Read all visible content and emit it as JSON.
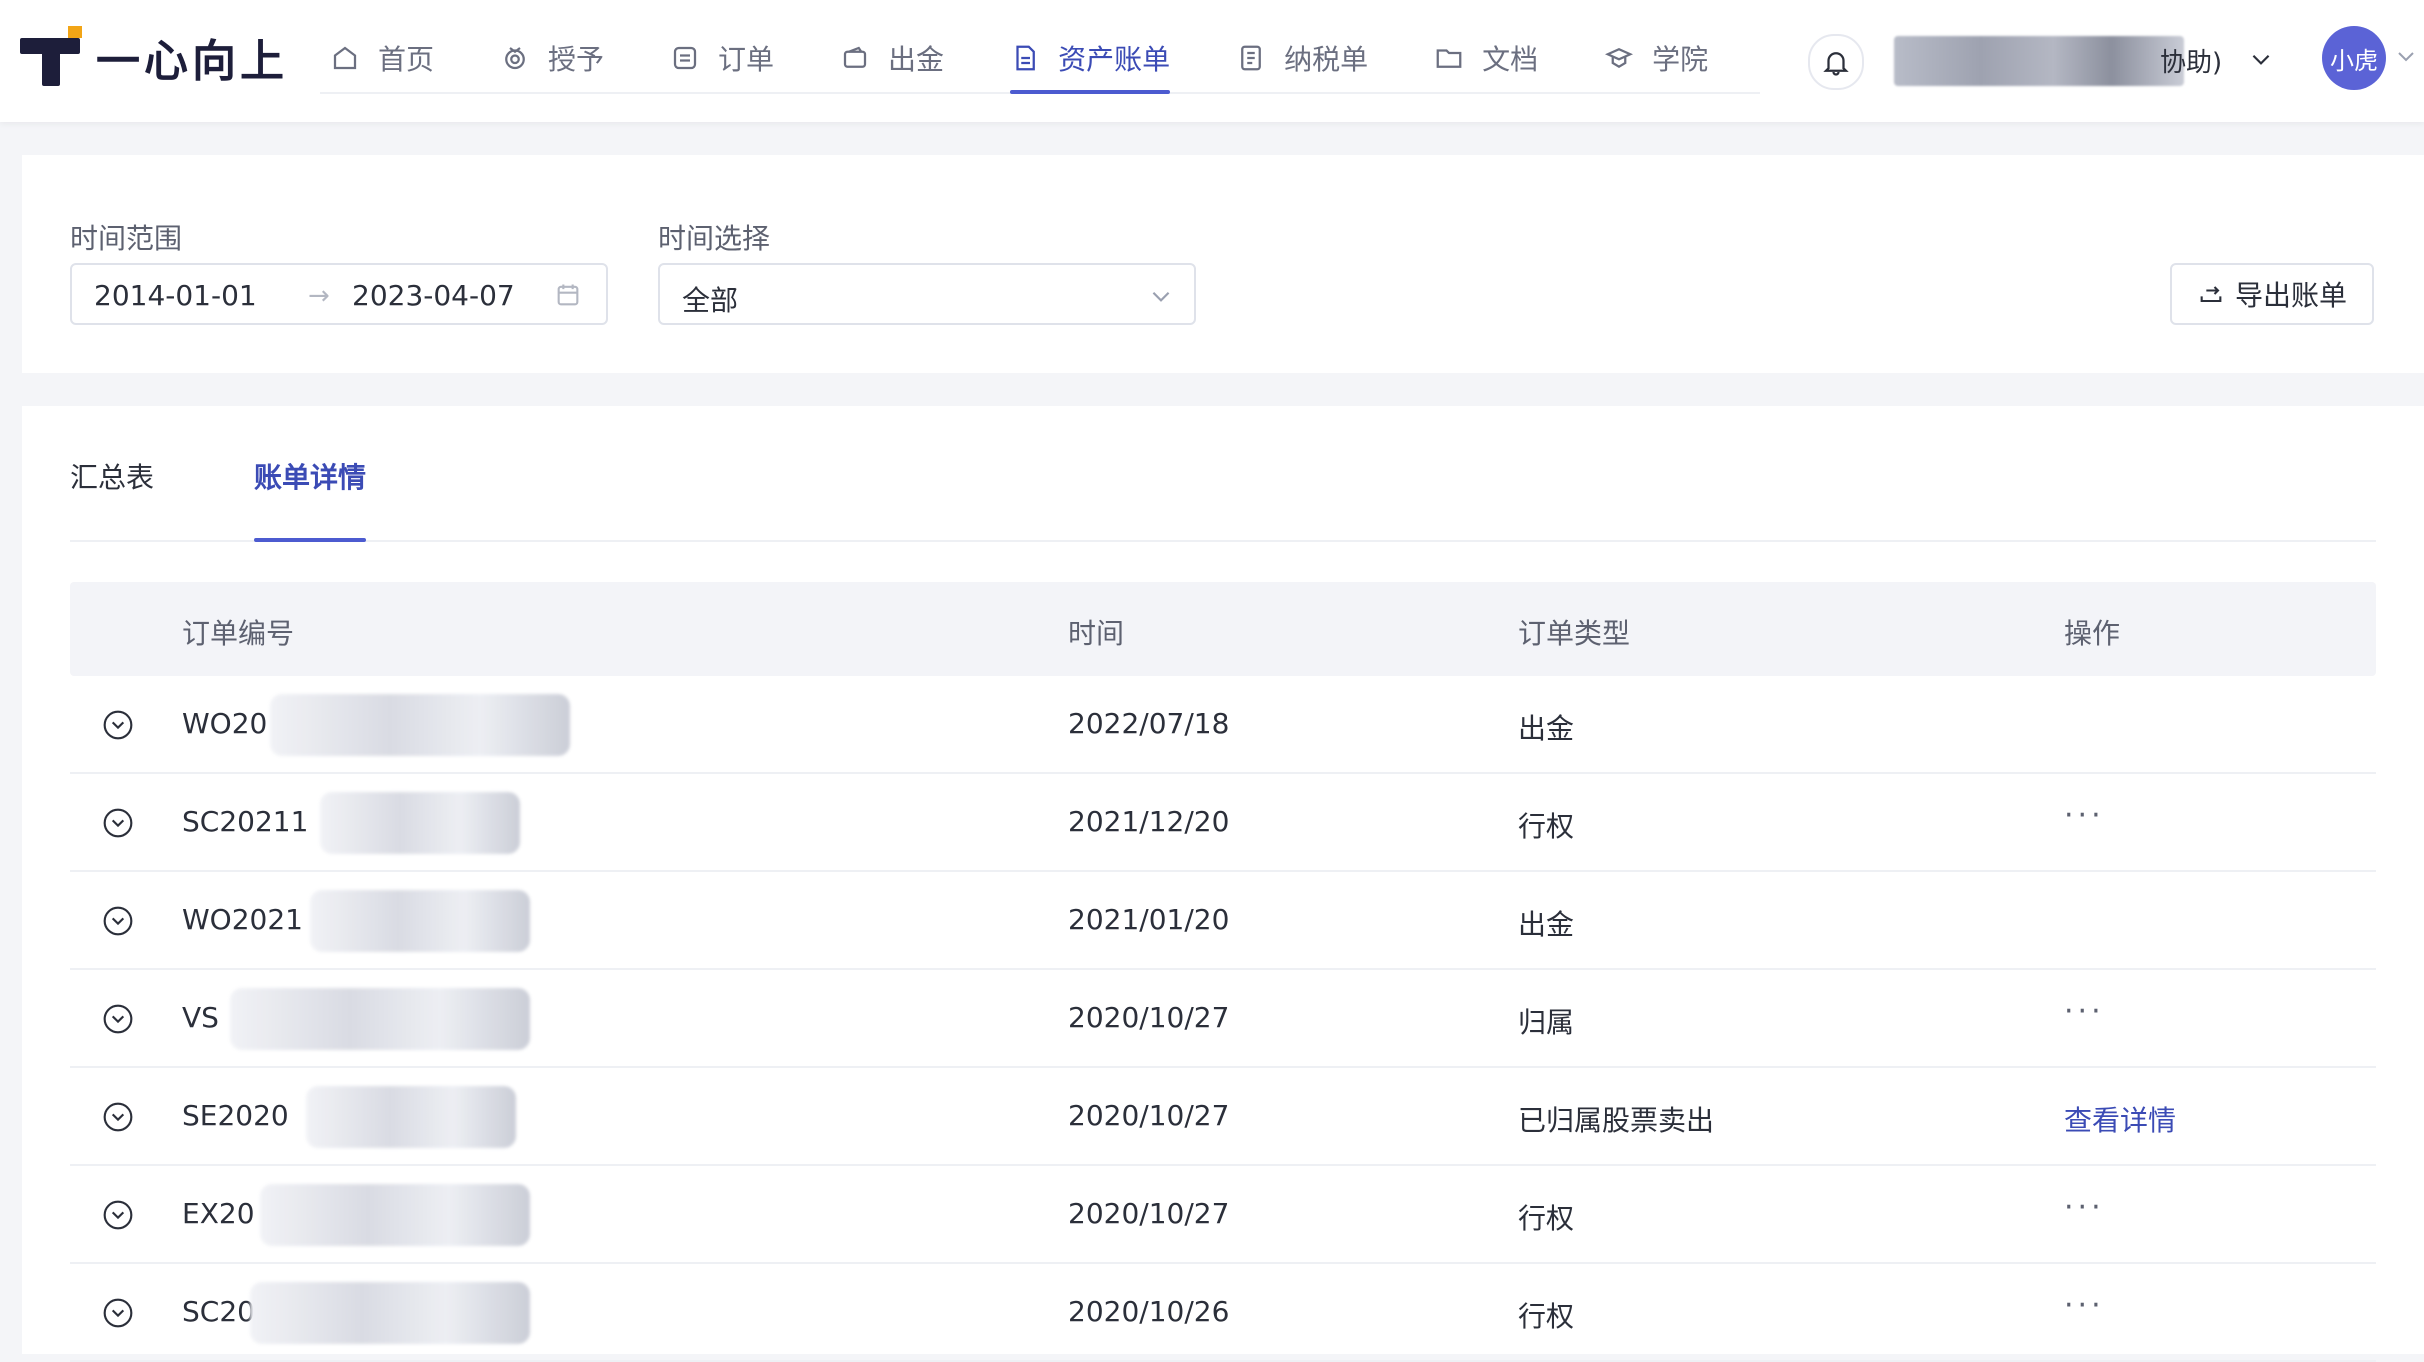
{
  "app": {
    "brand": "一心向上",
    "nav": [
      {
        "label": "首页",
        "icon": "home-icon"
      },
      {
        "label": "授予",
        "icon": "gift-icon"
      },
      {
        "label": "订单",
        "icon": "order-icon"
      },
      {
        "label": "出金",
        "icon": "wallet-icon"
      },
      {
        "label": "资产账单",
        "icon": "document-icon",
        "active": true
      },
      {
        "label": "纳税单",
        "icon": "tax-icon"
      },
      {
        "label": "文档",
        "icon": "folder-icon"
      },
      {
        "label": "学院",
        "icon": "graduation-icon"
      }
    ],
    "user": {
      "name_suffix": "协助)",
      "avatar": "小虎"
    },
    "accent_color": "#4c5bd0"
  },
  "filters": {
    "range_label": "时间范围",
    "range_start": "2014-01-01",
    "range_end": "2023-04-07",
    "time_label": "时间选择",
    "time_value": "全部",
    "export_label": "导出账单"
  },
  "tabs": [
    {
      "label": "汇总表",
      "active": false
    },
    {
      "label": "账单详情",
      "active": true
    }
  ],
  "table": {
    "columns": [
      "订单编号",
      "时间",
      "订单类型",
      "操作"
    ],
    "rows": [
      {
        "id": "WO20",
        "time": "2022/07/18",
        "type": "出金",
        "action": ""
      },
      {
        "id": "SC20211",
        "time": "2021/12/20",
        "type": "行权",
        "action": "···"
      },
      {
        "id": "WO2021",
        "time": "2021/01/20",
        "type": "出金",
        "action": ""
      },
      {
        "id": "VS",
        "time": "2020/10/27",
        "type": "归属",
        "action": "···"
      },
      {
        "id": "SE2020",
        "time": "2020/10/27",
        "type": "已归属股票卖出",
        "action": "查看详情"
      },
      {
        "id": "EX20",
        "time": "2020/10/27",
        "type": "行权",
        "action": "···"
      },
      {
        "id": "SC20",
        "time": "2020/10/26",
        "type": "行权",
        "action": "···"
      }
    ]
  }
}
